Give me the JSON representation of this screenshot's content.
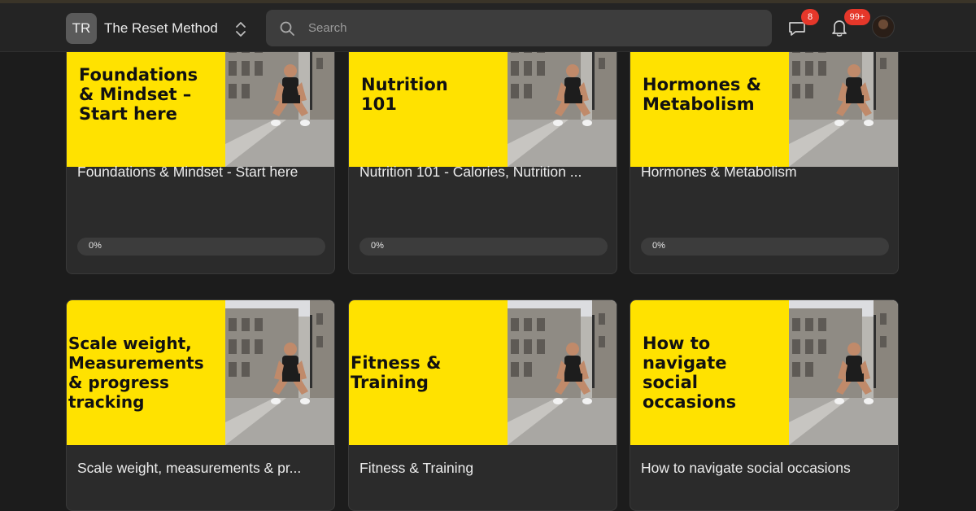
{
  "header": {
    "brand_initials": "TR",
    "brand_name": "The Reset Method",
    "search_placeholder": "Search",
    "chat_badge": "8",
    "notification_badge": "99+"
  },
  "courses": [
    {
      "thumbnail_text": "Foundations\n& Mindset –\nStart here",
      "title": "Foundations & Mindset - Start here",
      "progress_label": "0%",
      "progress": 0
    },
    {
      "thumbnail_text": "Nutrition\n101",
      "title": "Nutrition 101 - Calories, Nutrition ...",
      "progress_label": "0%",
      "progress": 0
    },
    {
      "thumbnail_text": "Hormones &\nMetabolism",
      "title": "Hormones & Metabolism",
      "progress_label": "0%",
      "progress": 0
    },
    {
      "thumbnail_text": "Scale weight,\nMeasurements\n& progress\ntracking",
      "title": "Scale weight, measurements & pr...",
      "progress_label": "",
      "progress": null
    },
    {
      "thumbnail_text": "Fitness &\nTraining",
      "title": "Fitness & Training",
      "progress_label": "",
      "progress": null
    },
    {
      "thumbnail_text": "How to\nnavigate\nsocial\noccasions",
      "title": "How to navigate social occasions",
      "progress_label": "",
      "progress": null
    }
  ],
  "colors": {
    "thumbnail_accent": "#ffe200",
    "badge": "#e5372a"
  }
}
